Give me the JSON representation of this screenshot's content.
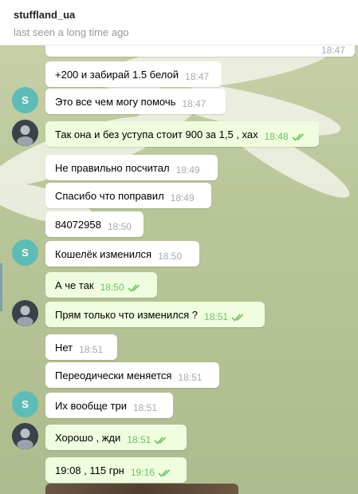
{
  "header": {
    "name": "stuffland_ua",
    "status": "last seen a long time ago"
  },
  "partial_top_time": "18:47",
  "contact_initial": "S",
  "messages": [
    {
      "text": "+200 и забирай 1.5 белой",
      "time": "18:47",
      "out": false
    },
    {
      "text": "Это все чем могу помочь",
      "time": "18:47",
      "out": false
    },
    {
      "text": "Так она и без уступа стоит 900 за 1,5 , хах",
      "time": "18:48",
      "out": true
    },
    {
      "text": "Не правильно посчитал",
      "time": "18:49",
      "out": false
    },
    {
      "text": "Спасибо что поправил",
      "time": "18:49",
      "out": false
    },
    {
      "text": "84072958",
      "time": "18:50",
      "out": false
    },
    {
      "text": "Кошелёк изменился",
      "time": "18:50",
      "out": false
    },
    {
      "text": "А че так",
      "time": "18:50",
      "out": true
    },
    {
      "text": "Прям только что изменился ?",
      "time": "18:51",
      "out": true
    },
    {
      "text": "Нет",
      "time": "18:51",
      "out": false
    },
    {
      "text": "Переодически меняется",
      "time": "18:51",
      "out": false
    },
    {
      "text": "Их вообще три",
      "time": "18:51",
      "out": false
    },
    {
      "text": "Хорошо , жди",
      "time": "18:51",
      "out": true
    },
    {
      "text": "19:08 , 115 грн",
      "time": "19:16",
      "out": true
    }
  ],
  "colors": {
    "incoming": "#ffffff",
    "outgoing": "#effdde",
    "read_ticks": "#6cc264",
    "avatar_contact": "#5fbcb5"
  }
}
